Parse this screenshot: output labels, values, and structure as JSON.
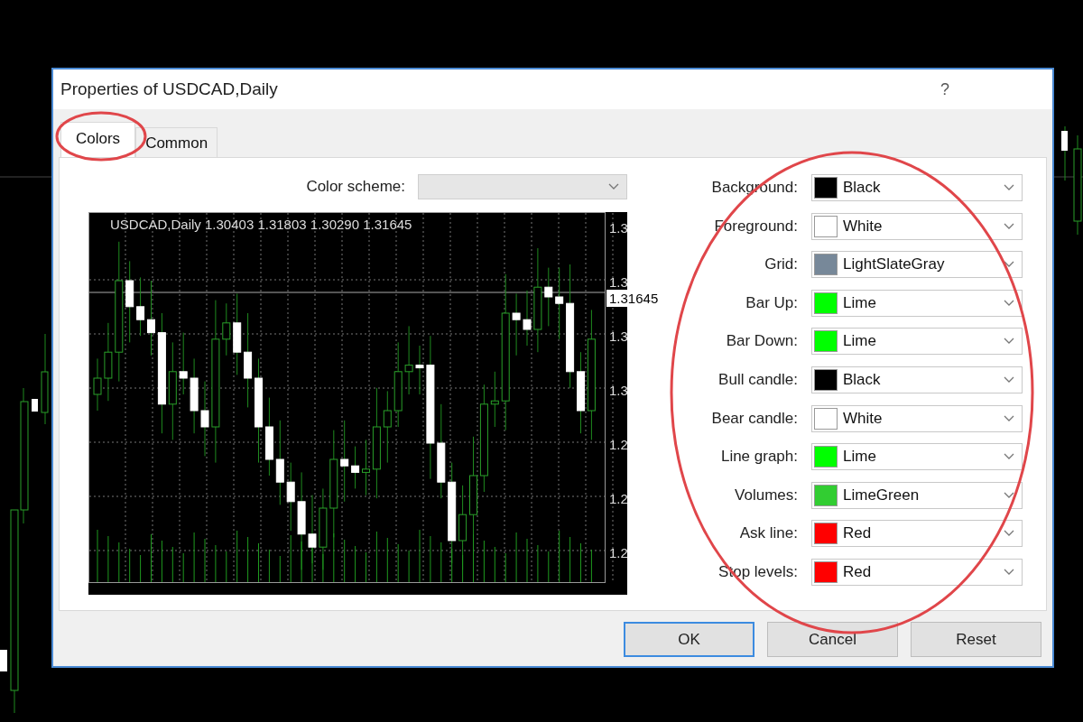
{
  "window": {
    "title": "Properties of USDCAD,Daily",
    "help": "?"
  },
  "tabs": [
    {
      "label": "Colors",
      "selected": true,
      "highlighted": true
    },
    {
      "label": "Common",
      "selected": false,
      "highlighted": false
    }
  ],
  "color_scheme": {
    "label": "Color scheme:"
  },
  "preview": {
    "header": "USDCAD,Daily  1.30403 1.31803 1.30290 1.31645",
    "price_tag": "1.31645",
    "axis_labels": [
      "1.3",
      "1.3",
      "1.3",
      "1.3",
      "1.2",
      "1.2",
      "1.2"
    ]
  },
  "properties": {
    "highlighted": true,
    "items": [
      {
        "label": "Background:",
        "value": "Black",
        "color": "#000000"
      },
      {
        "label": "Foreground:",
        "value": "White",
        "color": "#ffffff"
      },
      {
        "label": "Grid:",
        "value": "LightSlateGray",
        "color": "#778899"
      },
      {
        "label": "Bar Up:",
        "value": "Lime",
        "color": "#00ff00"
      },
      {
        "label": "Bar Down:",
        "value": "Lime",
        "color": "#00ff00"
      },
      {
        "label": "Bull candle:",
        "value": "Black",
        "color": "#000000"
      },
      {
        "label": "Bear candle:",
        "value": "White",
        "color": "#ffffff"
      },
      {
        "label": "Line graph:",
        "value": "Lime",
        "color": "#00ff00"
      },
      {
        "label": "Volumes:",
        "value": "LimeGreen",
        "color": "#32cd32"
      },
      {
        "label": "Ask line:",
        "value": "Red",
        "color": "#ff0000"
      },
      {
        "label": "Stop levels:",
        "value": "Red",
        "color": "#ff0000"
      }
    ]
  },
  "buttons": [
    {
      "label": "OK",
      "kind": "default"
    },
    {
      "label": "Cancel",
      "kind": "normal"
    },
    {
      "label": "Reset",
      "kind": "normal"
    }
  ]
}
